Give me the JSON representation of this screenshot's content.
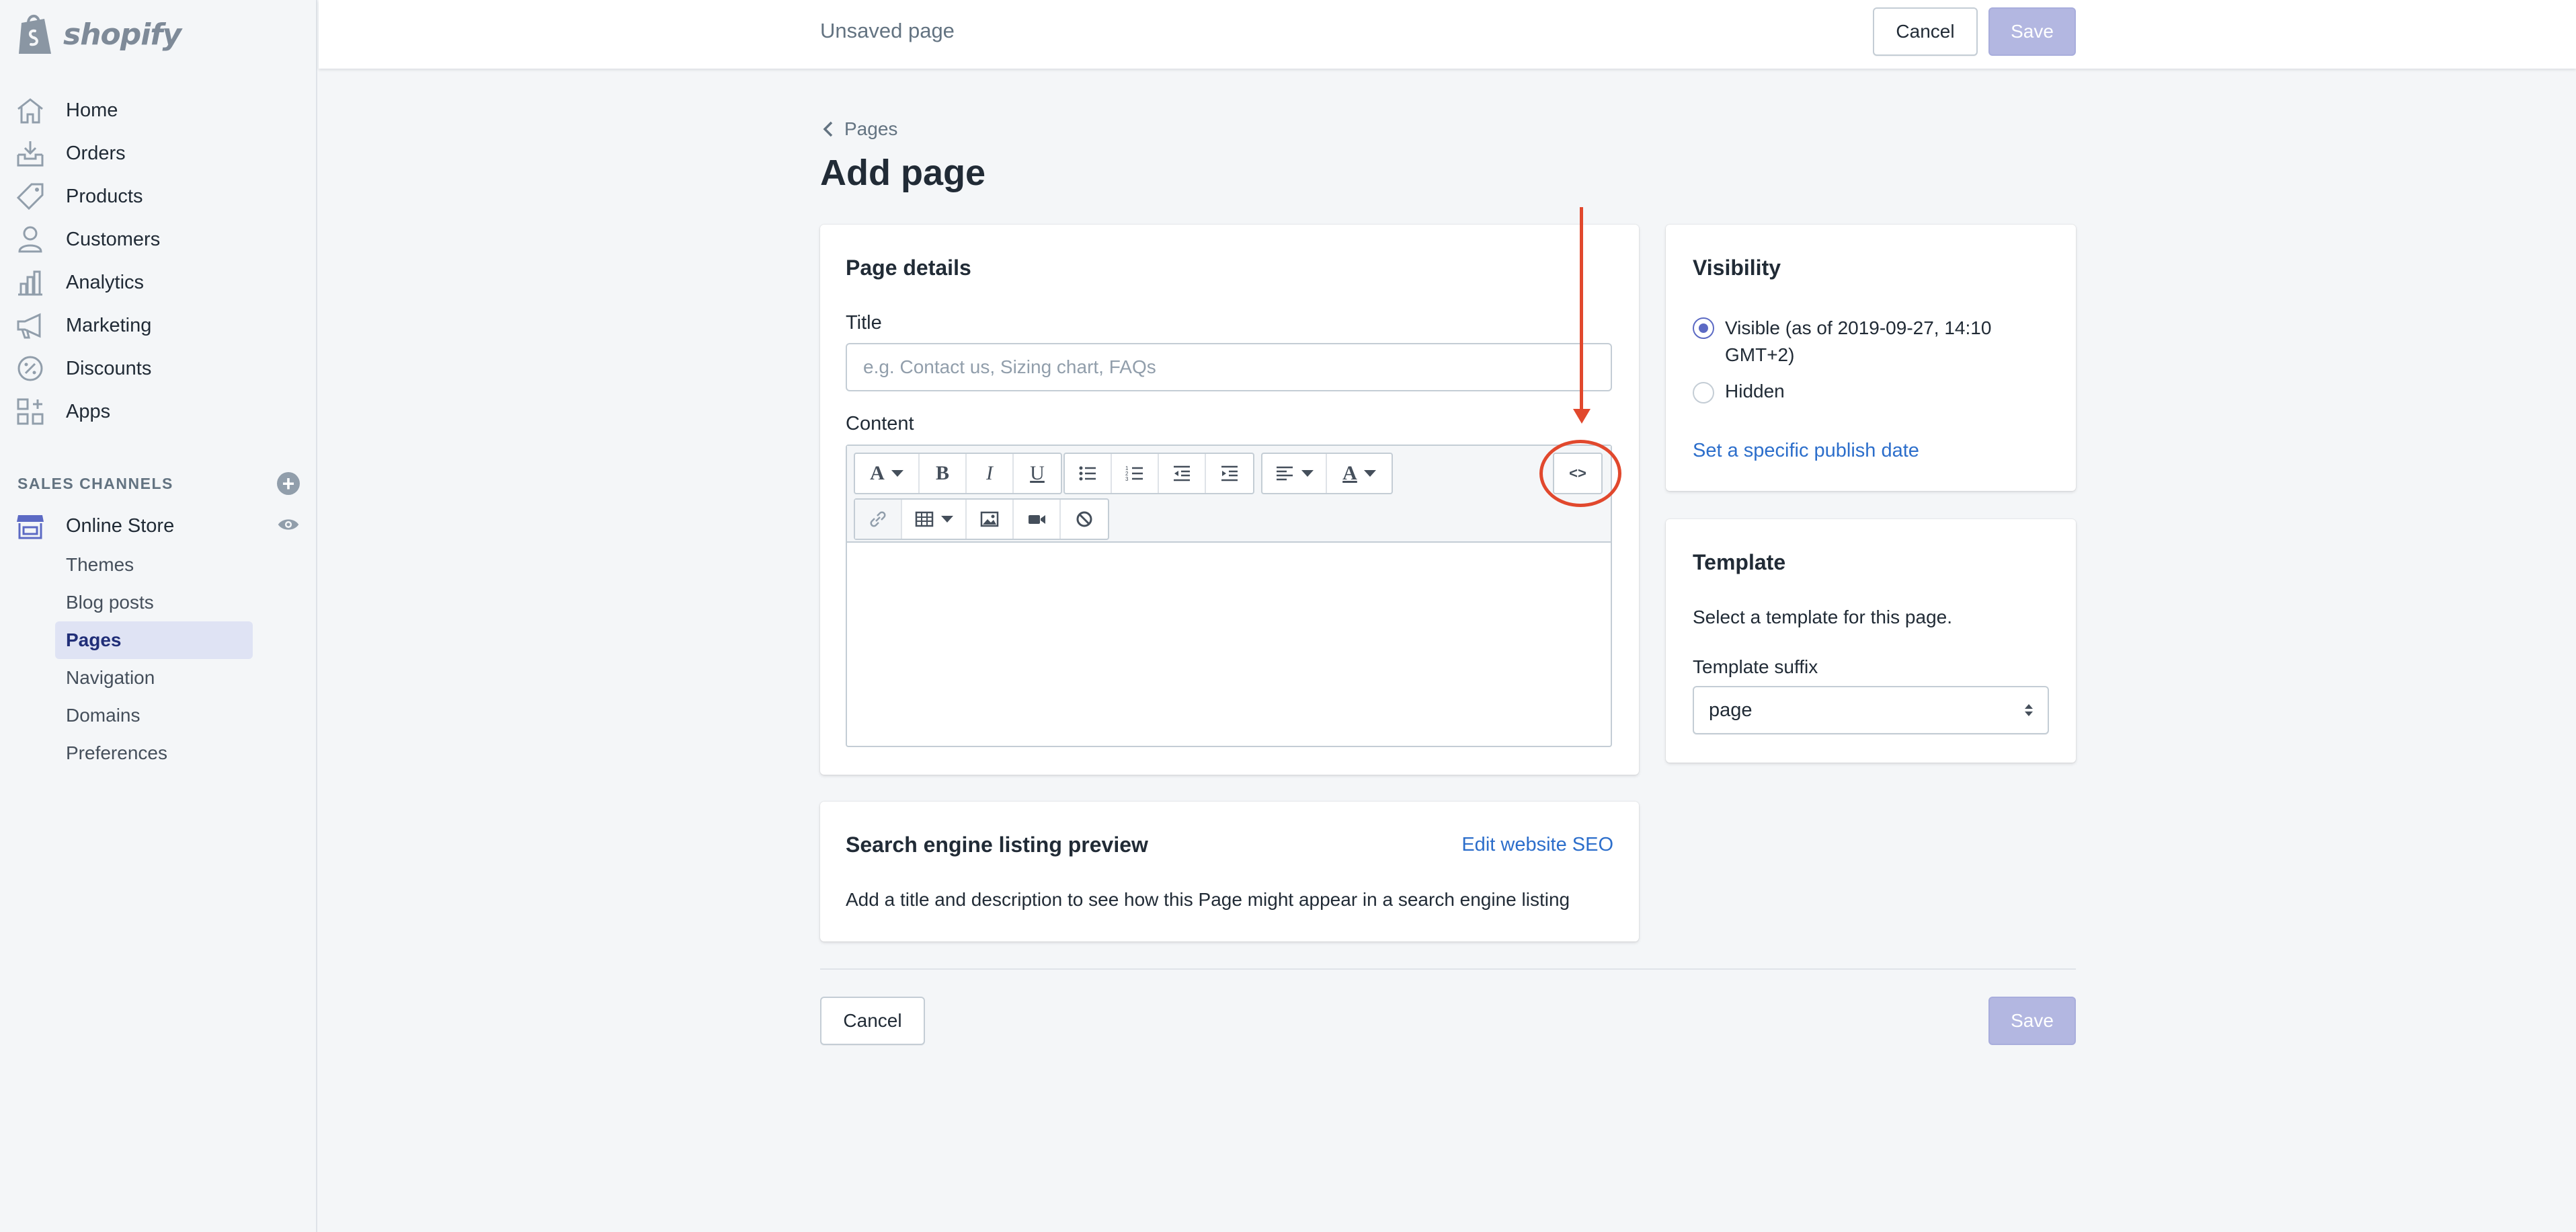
{
  "app": {
    "logo_text": "shopify"
  },
  "sidebar": {
    "items": [
      {
        "label": "Home",
        "icon": "home-icon"
      },
      {
        "label": "Orders",
        "icon": "orders-icon"
      },
      {
        "label": "Products",
        "icon": "tag-icon"
      },
      {
        "label": "Customers",
        "icon": "person-icon"
      },
      {
        "label": "Analytics",
        "icon": "bar-chart-icon"
      },
      {
        "label": "Marketing",
        "icon": "megaphone-icon"
      },
      {
        "label": "Discounts",
        "icon": "discount-icon"
      },
      {
        "label": "Apps",
        "icon": "apps-grid-icon"
      }
    ],
    "sales_channels_heading": "SALES CHANNELS",
    "online_store": "Online Store",
    "sub_items": [
      {
        "label": "Themes",
        "active": false
      },
      {
        "label": "Blog posts",
        "active": false
      },
      {
        "label": "Pages",
        "active": true
      },
      {
        "label": "Navigation",
        "active": false
      },
      {
        "label": "Domains",
        "active": false
      },
      {
        "label": "Preferences",
        "active": false
      }
    ]
  },
  "topbar": {
    "title": "Unsaved page",
    "cancel": "Cancel",
    "save": "Save"
  },
  "main": {
    "breadcrumb": "Pages",
    "title": "Add page",
    "page_details": {
      "heading": "Page details",
      "title_label": "Title",
      "title_placeholder": "e.g. Contact us, Sizing chart, FAQs",
      "content_label": "Content",
      "html_button": "<>"
    },
    "seo": {
      "heading": "Search engine listing preview",
      "edit_link": "Edit website SEO",
      "description": "Add a title and description to see how this Page might appear in a search engine listing"
    },
    "visibility": {
      "heading": "Visibility",
      "visible_label": "Visible (as of 2019-09-27, 14:10 GMT+2)",
      "hidden_label": "Hidden",
      "publish_link": "Set a specific publish date",
      "selected": "visible"
    },
    "template": {
      "heading": "Template",
      "description": "Select a template for this page.",
      "suffix_label": "Template suffix",
      "suffix_value": "page"
    },
    "footer": {
      "cancel": "Cancel",
      "save": "Save"
    }
  },
  "colors": {
    "accent": "#5c6ac4",
    "link": "#2c6ecb",
    "annotation": "#e1482d",
    "save_disabled": "#b3b7e1"
  }
}
